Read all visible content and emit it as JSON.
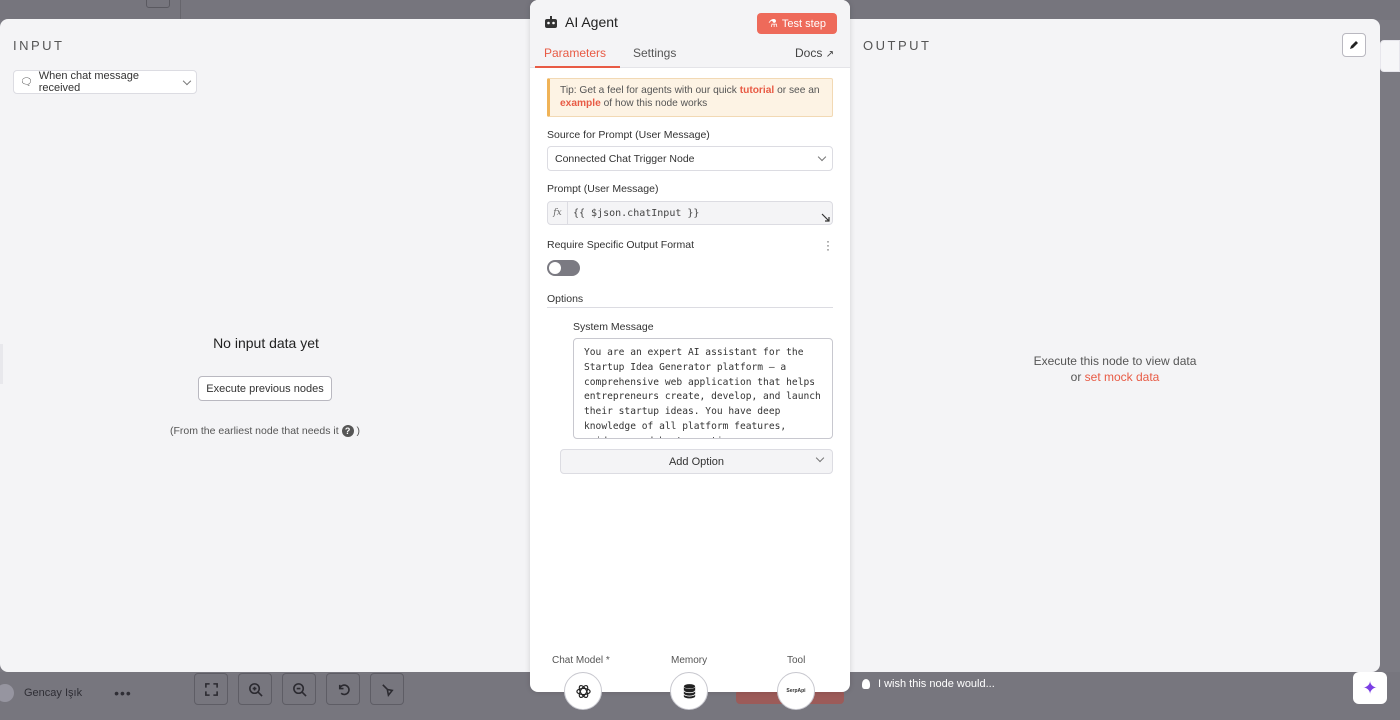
{
  "background": {
    "user_name": "Gencay Işık",
    "more_label": "•••",
    "wish_text": "I wish this node would...",
    "ai_icon": "sparkle-icon"
  },
  "input_panel": {
    "title": "INPUT",
    "trigger_select": "When chat message received",
    "no_data": "No input data yet",
    "execute_previous": "Execute previous nodes",
    "earliest_note": "(From the earliest node that needs it",
    "earliest_close": ")"
  },
  "output_panel": {
    "title": "OUTPUT",
    "message_line1": "Execute this node to view data",
    "message_or": "or",
    "mock_link": "set mock data"
  },
  "node": {
    "title": "AI Agent",
    "test_step": "Test step",
    "tabs": [
      "Parameters",
      "Settings"
    ],
    "docs": "Docs",
    "tip_prefix": "Tip: Get a feel for agents with our quick",
    "tip_link1": "tutorial",
    "tip_middle": "or see an",
    "tip_link2": "example",
    "tip_suffix": "of how this node works",
    "source_label": "Source for Prompt (User Message)",
    "source_value": "Connected Chat Trigger Node",
    "prompt_label": "Prompt (User Message)",
    "prompt_fx": "fx",
    "prompt_value": "{{ $json.chatInput }}",
    "output_format_label": "Require Specific Output Format",
    "output_format_enabled": false,
    "options_label": "Options",
    "system_message_label": "System Message",
    "system_message": "You are an expert AI assistant for the Startup Idea Generator platform — a comprehensive web application that helps entrepreneurs create, develop, and launch their startup ideas. You have deep knowledge of all platform features, guidance and best practices",
    "add_option": "Add Option",
    "connectors": [
      {
        "label": "Chat Model *",
        "icon": "openai-icon"
      },
      {
        "label": "Memory",
        "icon": "database-icon"
      },
      {
        "label": "Tool",
        "icon": "serpapi-logo",
        "logo_text": "SerpApi"
      }
    ]
  }
}
